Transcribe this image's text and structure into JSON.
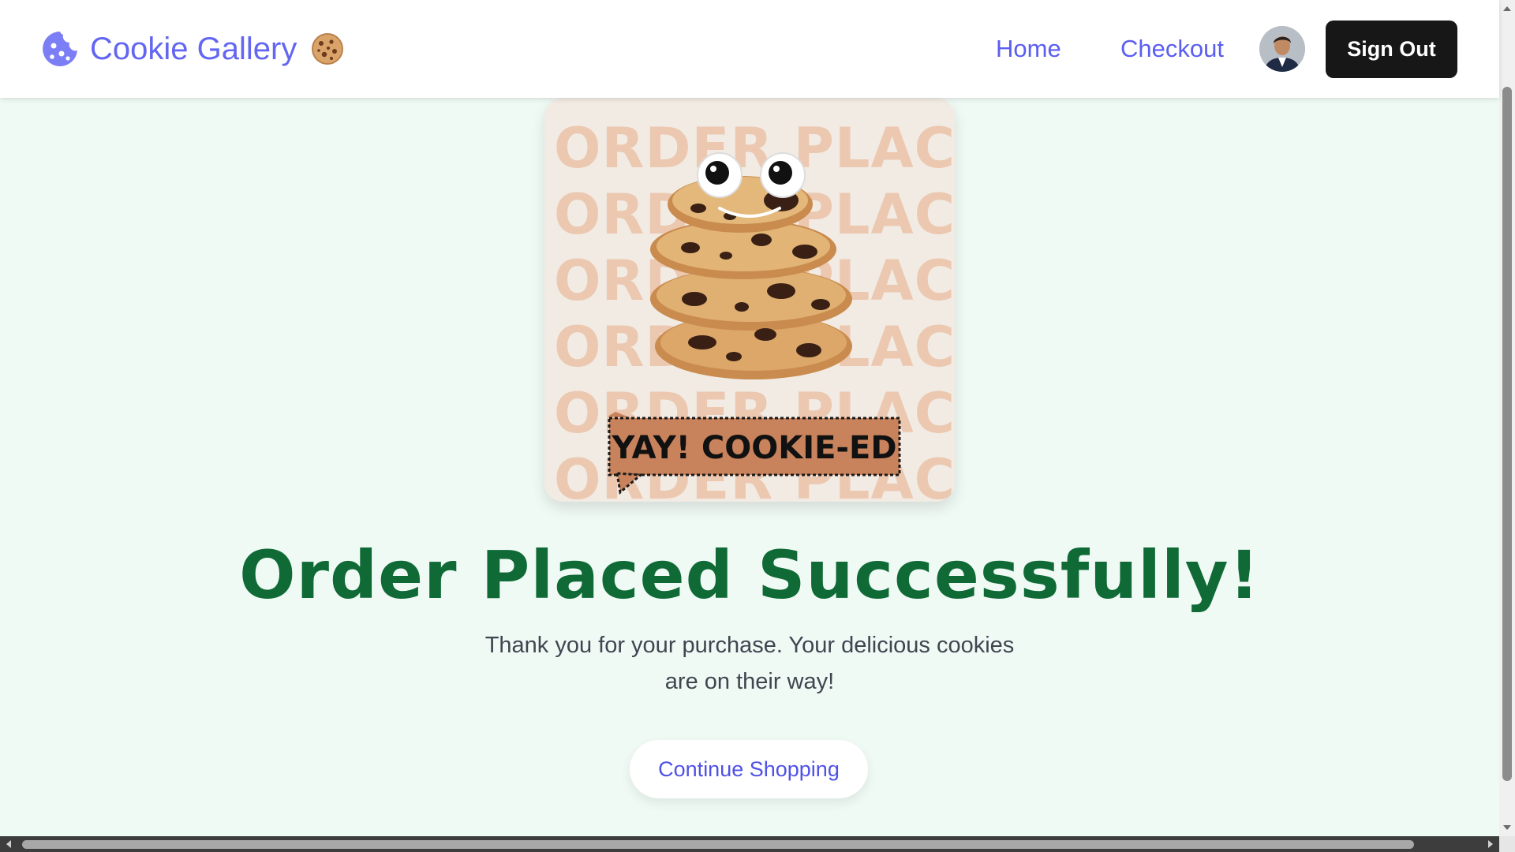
{
  "app": {
    "name": "Cookie Gallery",
    "emoji_icon": "cookie-emoji-icon",
    "logo_icon": "cookie-bite-icon",
    "brand_color": "#6366f1"
  },
  "nav": {
    "home_label": "Home",
    "checkout_label": "Checkout",
    "avatar_icon": "user-avatar",
    "signout_label": "Sign Out"
  },
  "hero": {
    "background_text": "ORDER PLACED",
    "speech_bubble_text": "YAY! COOKIE-ED"
  },
  "confirmation": {
    "title": "Order Placed Successfully!",
    "message": "Thank you for your purchase. Your delicious cookies are on their way!",
    "continue_label": "Continue Shopping",
    "title_color": "#0f6a36",
    "page_background": "#f0faf5"
  }
}
